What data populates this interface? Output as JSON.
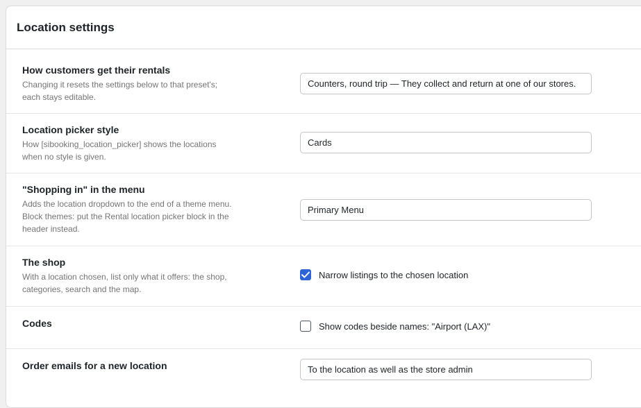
{
  "header": {
    "title": "Location settings"
  },
  "rows": [
    {
      "name": "How customers get their rentals",
      "desc_lines": [
        "Changing it resets the settings below to that preset's;",
        "each stays editable."
      ],
      "value": "Counters, round trip — They collect and return at one of our stores."
    },
    {
      "name": "Location picker style",
      "desc_lines": [
        "How [sibooking_location_picker] shows the locations",
        "when no style is given."
      ],
      "value": "Cards"
    },
    {
      "name": "\"Shopping in\" in the menu",
      "desc_lines": [
        "Adds the location dropdown to the end of a theme menu.",
        "Block themes: put the Rental location picker block in the",
        "header instead."
      ],
      "value": "Primary Menu"
    },
    {
      "name": "The shop",
      "desc_lines": [
        "With a location chosen, list only what it offers: the shop,",
        "categories, search and the map."
      ],
      "checkbox_label": "Narrow listings to the chosen location",
      "checked": true
    },
    {
      "name": "Codes",
      "checkbox_label": "Show codes beside names: \"Airport (LAX)\"",
      "checked": false
    },
    {
      "name": "Order emails for a new location",
      "value": "To the location as well as the store admin"
    }
  ],
  "colors": {
    "accent": "#2f63d8",
    "muted_text": "#757575",
    "border": "#dcdcde"
  },
  "icons": {
    "checkmark": "check-icon"
  }
}
